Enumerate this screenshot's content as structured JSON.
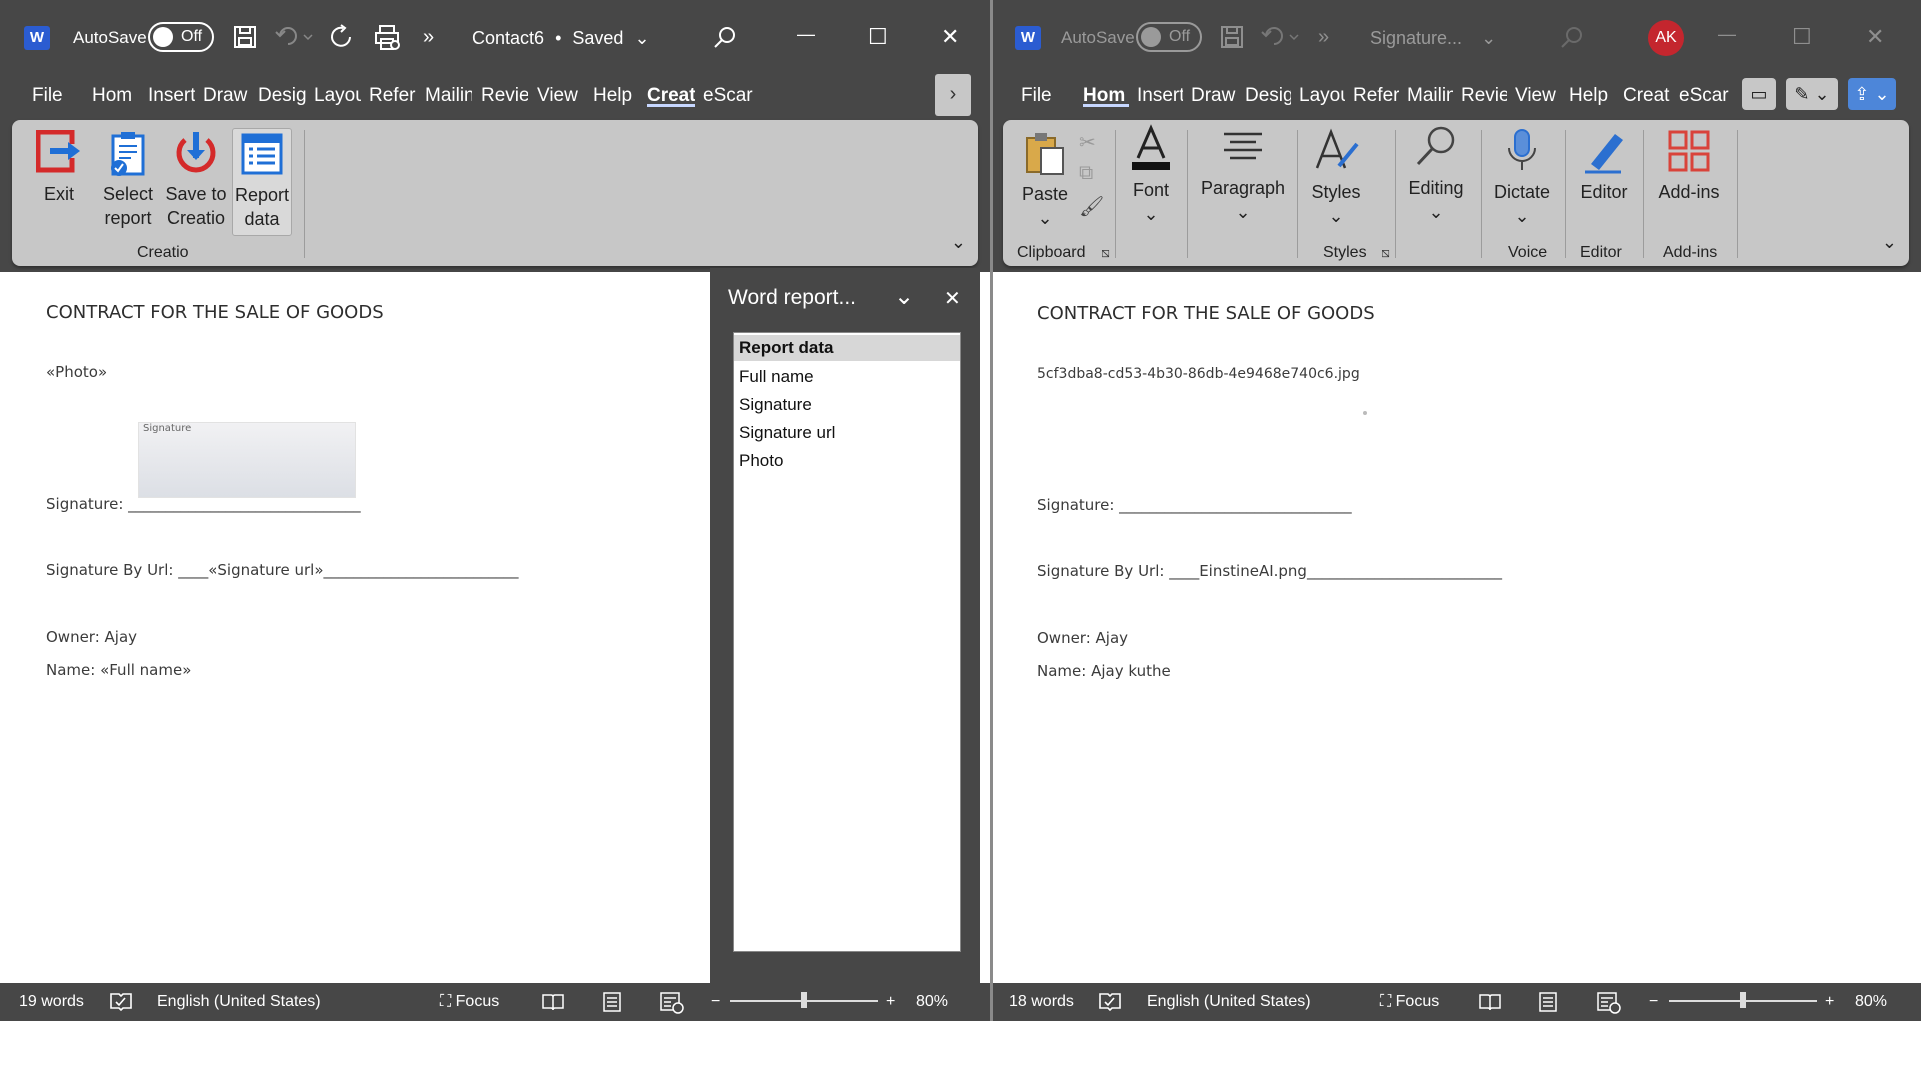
{
  "left": {
    "title": {
      "autosave_label": "AutoSave",
      "autosave_state": "Off",
      "doc_name": "Contact6",
      "separator": "•",
      "save_status": "Saved",
      "more": "»",
      "minimize": "—",
      "maximize": "☐",
      "close": "✕"
    },
    "tabs": [
      "File",
      "Hom",
      "Insert",
      "Draw",
      "Desig",
      "Layou",
      "Refer",
      "Mailin",
      "Revie",
      "View",
      "Help",
      "Creat",
      "eScar"
    ],
    "active_tab": "Creat",
    "ribbon_more": "›",
    "ribbon": {
      "buttons": [
        {
          "line1": "Exit",
          "line2": ""
        },
        {
          "line1": "Select",
          "line2": "report"
        },
        {
          "line1": "Save to",
          "line2": "Creatio"
        },
        {
          "line1": "Report",
          "line2": "data"
        }
      ],
      "group": "Creatio"
    },
    "document": {
      "heading": "CONTRACT FOR THE SALE OF GOODS",
      "photo": "«Photo»",
      "signature_image_text": "Signature",
      "signature_line": "Signature: _______________________________",
      "signature_url_line": "Signature By Url: ____«Signature url»__________________________",
      "owner_line": "Owner: Ajay",
      "name_line": "Name: «Full name»"
    },
    "pane": {
      "title": "Word report...",
      "items": [
        "Report data",
        "Full name",
        "Signature",
        "Signature url",
        "Photo"
      ]
    },
    "status": {
      "words": "19 words",
      "language": "English (United States)",
      "focus": "Focus",
      "zoom": "80%"
    }
  },
  "right": {
    "title": {
      "autosave_label": "AutoSave",
      "autosave_state": "Off",
      "doc_name": "Signature...",
      "avatar": "AK",
      "more": "»",
      "minimize": "—",
      "maximize": "☐",
      "close": "✕"
    },
    "tabs": [
      "File",
      "Hom",
      "Insert",
      "Draw",
      "Desig",
      "Layou",
      "Refer",
      "Mailin",
      "Revie",
      "View",
      "Help",
      "Creat",
      "eScar"
    ],
    "active_tab": "Hom",
    "ribbon": {
      "paste": "Paste",
      "font": "Font",
      "paragraph": "Paragraph",
      "styles": "Styles",
      "editing": "Editing",
      "dictate": "Dictate",
      "editor": "Editor",
      "addins": "Add-ins",
      "groups": [
        "Clipboard",
        "Styles",
        "Voice",
        "Editor",
        "Add-ins"
      ]
    },
    "document": {
      "heading": "CONTRACT FOR THE SALE OF GOODS",
      "photo": "5cf3dba8-cd53-4b30-86db-4e9468e740c6.jpg",
      "signature_line": "Signature: _______________________________",
      "signature_url_line": "Signature By Url: ____EinstineAI.png__________________________",
      "owner_line": "Owner: Ajay",
      "name_line": "Name: Ajay kuthe"
    },
    "status": {
      "words": "18 words",
      "language": "English (United States)",
      "focus": "Focus",
      "zoom": "80%"
    }
  },
  "colors": {
    "titlebar": "#474747",
    "ribbon": "#c7c7c7",
    "word_blue": "#2b5cd1",
    "avatar": "#c4262e"
  },
  "zoom_level_fraction": 0.5
}
